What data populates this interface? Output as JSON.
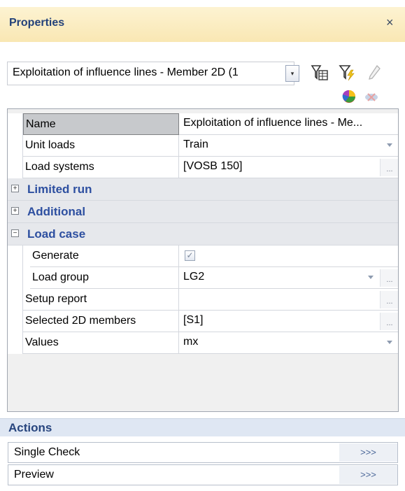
{
  "panel": {
    "title": "Properties",
    "close_glyph": "×"
  },
  "selector": {
    "value": "Exploitation of influence lines - Member 2D (1",
    "dropdown_glyph": "▾"
  },
  "toolbar": {
    "icons": [
      "filter-table-icon",
      "filter-lightning-icon",
      "pencil-icon",
      "color-palette-icon",
      "close-cross-disabled-icon"
    ]
  },
  "grid": {
    "rows": {
      "name": {
        "label": "Name",
        "value": "Exploitation of influence lines - Me..."
      },
      "unit_loads": {
        "label": "Unit loads",
        "value": "Train"
      },
      "load_systems": {
        "label": "Load systems",
        "value": "[VOSB 150]"
      },
      "generate": {
        "label": "Generate",
        "checked": true,
        "check_glyph": "✓"
      },
      "load_group": {
        "label": "Load group",
        "value": "LG2"
      },
      "setup_report": {
        "label": "Setup report",
        "value": ""
      },
      "selected_members": {
        "label": "Selected 2D members",
        "value": "[S1]"
      },
      "values": {
        "label": "Values",
        "value": "mx"
      }
    },
    "categories": {
      "limited_run": {
        "label": "Limited run",
        "expand_glyph": "+"
      },
      "additional": {
        "label": "Additional",
        "expand_glyph": "+"
      },
      "load_case": {
        "label": "Load case",
        "expand_glyph": "−"
      }
    },
    "ellipsis": "..."
  },
  "actions": {
    "title": "Actions",
    "items": [
      {
        "label": "Single Check",
        "button": ">>>"
      },
      {
        "label": "Preview",
        "button": ">>>"
      }
    ]
  },
  "colors": {
    "title_bar": "#f9e7b3",
    "title_text": "#24427a",
    "category_text": "#2d4fa0",
    "actions_header": "#dfe7f3"
  }
}
